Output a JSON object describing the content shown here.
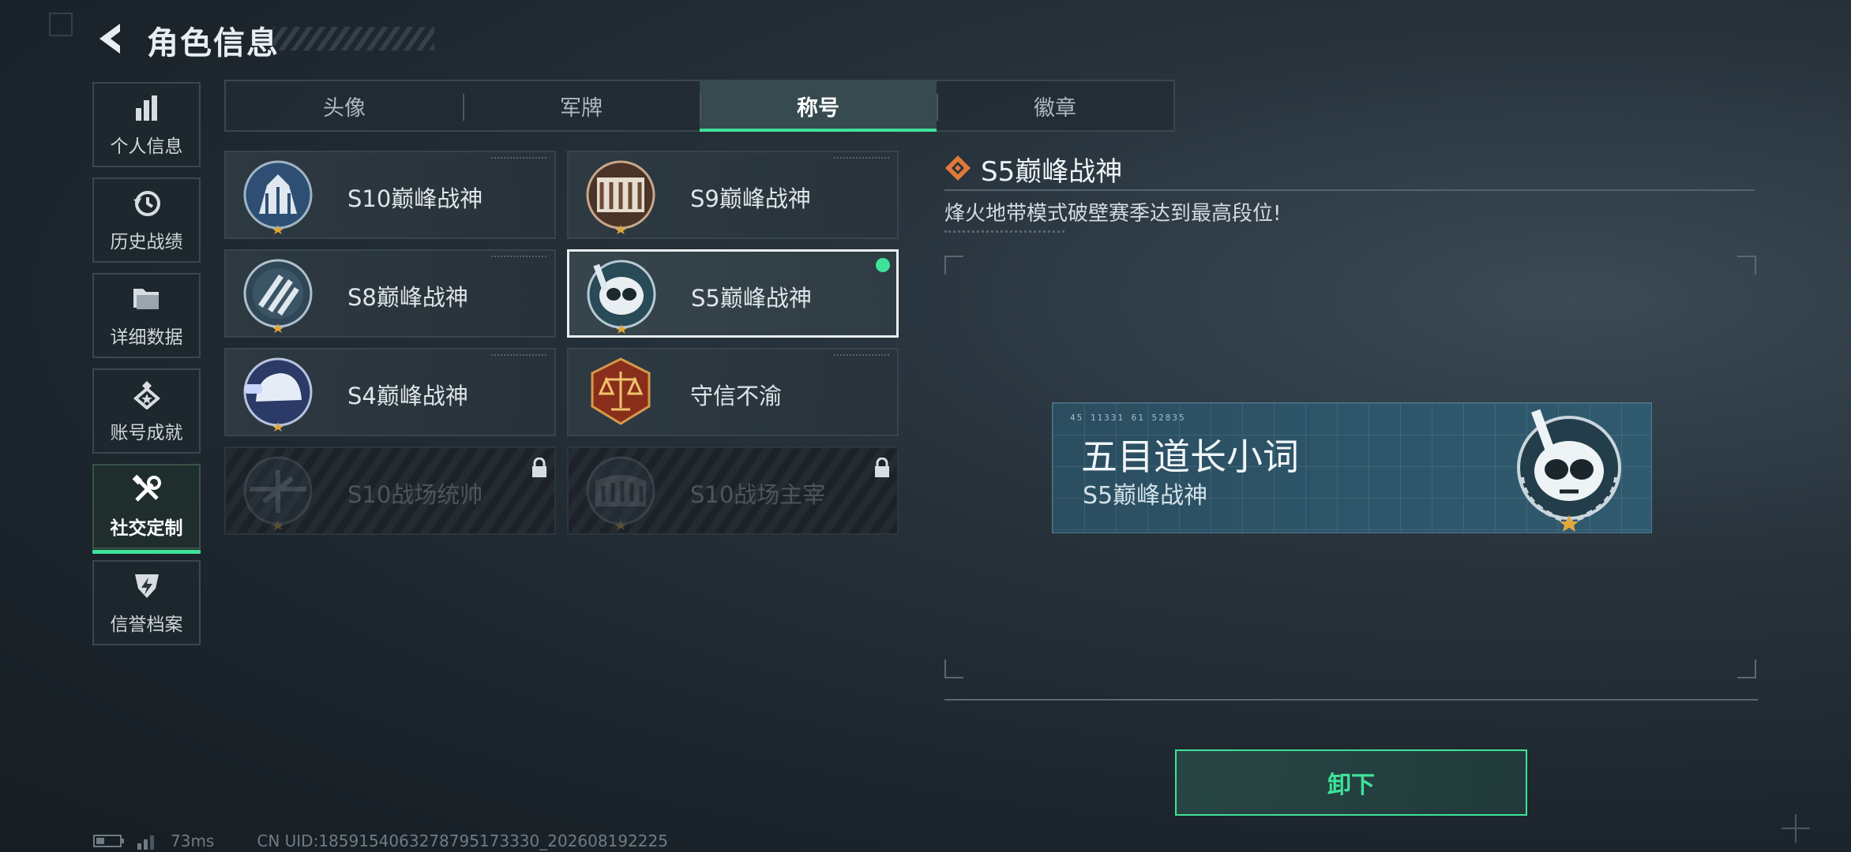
{
  "header": {
    "title": "角色信息",
    "back_icon": "back-arrow-icon"
  },
  "sidebar": {
    "items": [
      {
        "label": "个人信息",
        "icon": "bar-chart-icon",
        "active": false
      },
      {
        "label": "历史战绩",
        "icon": "history-clock-icon",
        "active": false
      },
      {
        "label": "详细数据",
        "icon": "folder-icon",
        "active": false
      },
      {
        "label": "账号成就",
        "icon": "medal-icon",
        "active": false
      },
      {
        "label": "社交定制",
        "icon": "tools-icon",
        "active": true
      },
      {
        "label": "信誉档案",
        "icon": "shield-bolt-icon",
        "active": false
      }
    ]
  },
  "tabs": [
    {
      "label": "头像",
      "active": false
    },
    {
      "label": "军牌",
      "active": false
    },
    {
      "label": "称号",
      "active": true
    },
    {
      "label": "徽章",
      "active": false
    }
  ],
  "titles": [
    {
      "name": "S10巅峰战神",
      "badge": "monument-badge-icon",
      "state": "owned"
    },
    {
      "name": "S9巅峰战神",
      "badge": "dam-badge-icon",
      "state": "owned"
    },
    {
      "name": "S8巅峰战神",
      "badge": "stripes-badge-icon",
      "state": "owned"
    },
    {
      "name": "S5巅峰战神",
      "badge": "diver-skull-badge-icon",
      "state": "selected"
    },
    {
      "name": "S4巅峰战神",
      "badge": "nightvision-helmet-badge-icon",
      "state": "owned"
    },
    {
      "name": "守信不渝",
      "badge": "scales-badge-icon",
      "state": "owned"
    },
    {
      "name": "S10战场统帅",
      "badge": "aircraft-badge-icon",
      "state": "locked"
    },
    {
      "name": "S10战场主宰",
      "badge": "colosseum-badge-icon",
      "state": "locked"
    }
  ],
  "detail": {
    "title": "S5巅峰战神",
    "description": "烽火地带模式破壁赛季达到最高段位!",
    "nameplate": {
      "meta": "45 11331  61 52835",
      "player_name": "五目道长小词",
      "title": "S5巅峰战神",
      "badge": "diver-skull-badge-icon"
    },
    "action_label": "卸下"
  },
  "status_bar": {
    "ping": "73ms",
    "uid": "CN UID:1859154063278795173330_202608192225"
  },
  "colors": {
    "accent": "#3ee29a",
    "background": "#1c252c"
  }
}
